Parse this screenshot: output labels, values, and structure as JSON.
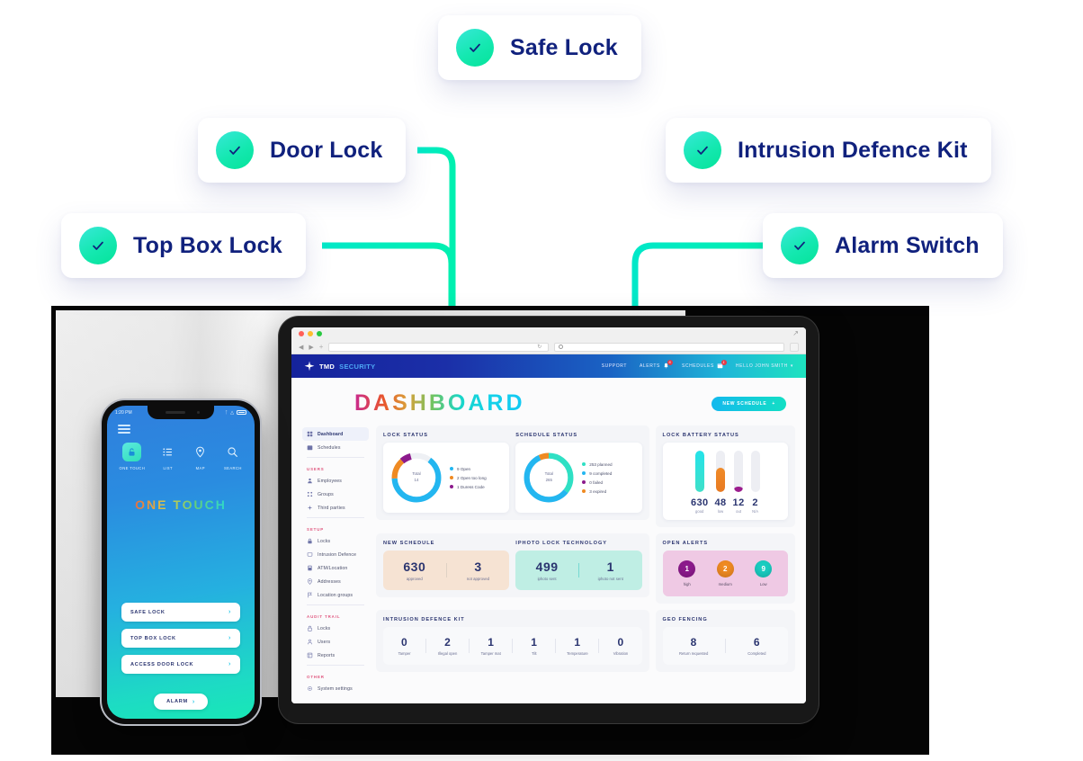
{
  "callouts": [
    {
      "id": "safe-lock",
      "label": "Safe Lock"
    },
    {
      "id": "door-lock",
      "label": "Door Lock"
    },
    {
      "id": "intrusion-kit",
      "label": "Intrusion Defence Kit"
    },
    {
      "id": "top-box-lock",
      "label": "Top Box Lock"
    },
    {
      "id": "alarm-switch",
      "label": "Alarm Switch"
    }
  ],
  "colors": {
    "connector_start": "#00d8ff",
    "connector_end": "#00f5a8",
    "callout_text": "#10217d",
    "accent_cyan": "#13b9ee",
    "accent_teal": "#13dfc4",
    "alert_high": "#8c1a8c",
    "alert_medium": "#ef8a22",
    "alert_low": "#19ccc0",
    "battery_good": "#17d8e8",
    "battery_low": "#ee832a",
    "battery_out": "#9c1d8e"
  },
  "tablet": {
    "browser": {
      "reload_icon": "reload-icon",
      "search_icon": "search-icon",
      "new_tab_icon": "plus-icon"
    },
    "appnav": {
      "brand_main": "TMD",
      "brand_sub": "SECURITY",
      "items": [
        {
          "label": "SUPPORT",
          "badge": null
        },
        {
          "label": "ALERTS",
          "badge": "6",
          "icon": "bell-icon"
        },
        {
          "label": "SCHEDULES",
          "badge": "1",
          "icon": "calendar-icon"
        },
        {
          "label": "HELLO JOHN SMITH",
          "badge": null,
          "icon": "chevron-down-icon"
        }
      ]
    },
    "page_title": "DASHBOARD",
    "new_schedule_button": "NEW SCHEDULE",
    "sidebar": [
      {
        "type": "item",
        "label": "Dashboard",
        "icon": "grid-icon",
        "active": true
      },
      {
        "type": "item",
        "label": "Schedules",
        "icon": "calendar-icon",
        "active": false
      },
      {
        "type": "divider"
      },
      {
        "type": "section",
        "label": "USERS"
      },
      {
        "type": "item",
        "label": "Employees",
        "icon": "user-icon",
        "active": false
      },
      {
        "type": "item",
        "label": "Groups",
        "icon": "groups-icon",
        "active": false
      },
      {
        "type": "item",
        "label": "Third parties",
        "icon": "plus-cross-icon",
        "active": false
      },
      {
        "type": "divider"
      },
      {
        "type": "section",
        "label": "SETUP"
      },
      {
        "type": "item",
        "label": "Locks",
        "icon": "lock-icon",
        "active": false
      },
      {
        "type": "item",
        "label": "Intrusion Defence",
        "icon": "shield-icon",
        "active": false
      },
      {
        "type": "item",
        "label": "ATM/Location",
        "icon": "atm-icon",
        "active": false
      },
      {
        "type": "item",
        "label": "Addresses",
        "icon": "pin-icon",
        "active": false
      },
      {
        "type": "item",
        "label": "Location groups",
        "icon": "flag-icon",
        "active": false
      },
      {
        "type": "divider"
      },
      {
        "type": "section",
        "label": "AUDIT TRAIL"
      },
      {
        "type": "item",
        "label": "Locks",
        "icon": "lock-icon",
        "active": false
      },
      {
        "type": "item",
        "label": "Users",
        "icon": "user-icon",
        "active": false
      },
      {
        "type": "item",
        "label": "Reports",
        "icon": "report-icon",
        "active": false
      },
      {
        "type": "divider"
      },
      {
        "type": "section",
        "label": "OTHER"
      },
      {
        "type": "item",
        "label": "System settings",
        "icon": "gear-icon",
        "active": false
      }
    ],
    "panels": {
      "lock_status": {
        "title": "LOCK STATUS",
        "total_label": "Total",
        "total_value": "14",
        "legend": [
          {
            "label": "9 Open",
            "color": "#23b6f0",
            "value": 9
          },
          {
            "label": "2 Open too long",
            "color": "#ef8a22",
            "value": 2
          },
          {
            "label": "1 Duress Code",
            "color": "#8c1a8c",
            "value": 1
          }
        ]
      },
      "schedule_status": {
        "title": "SCHEDULE STATUS",
        "total_label": "Total",
        "total_value": "265",
        "legend": [
          {
            "label": "253 planned",
            "color": "#2fe0c4",
            "value": 253
          },
          {
            "label": "9 completed",
            "color": "#23b6f0",
            "value": 9
          },
          {
            "label": "0 failed",
            "color": "#8c1a8c",
            "value": 0
          },
          {
            "label": "3 expired",
            "color": "#ef8a22",
            "value": 3
          }
        ]
      },
      "lock_battery_status": {
        "title": "LOCK BATTERY STATUS",
        "bars": [
          {
            "value": "630",
            "label": "good",
            "fill_pct": 100,
            "color": "#17d8e8"
          },
          {
            "value": "48",
            "label": "low",
            "fill_pct": 58,
            "color": "#ee832a"
          },
          {
            "value": "12",
            "label": "out",
            "fill_pct": 14,
            "color": "#9c1d8e"
          },
          {
            "value": "2",
            "label": "N/A",
            "fill_pct": 0,
            "color": "#edeef3"
          }
        ]
      },
      "new_schedule": {
        "title": "NEW SCHEDULE",
        "bg": "#f6e3d3",
        "stats": [
          {
            "value": "630",
            "label": "approved"
          },
          {
            "value": "3",
            "label": "not approved"
          }
        ]
      },
      "iphoto_lock_technology": {
        "title": "IPHOTO LOCK TECHNOLOGY",
        "bg": "#bfeee4",
        "stats": [
          {
            "value": "499",
            "label": "iphoto sent"
          },
          {
            "value": "1",
            "label": "iphoto not sent"
          }
        ]
      },
      "open_alerts": {
        "title": "OPEN ALERTS",
        "bg": "#efc9e4",
        "alerts": [
          {
            "value": "1",
            "label": "high",
            "color": "#8c1a8c"
          },
          {
            "value": "2",
            "label": "medium",
            "color": "#ef8a22"
          },
          {
            "value": "9",
            "label": "Low",
            "color": "#19ccc0"
          }
        ]
      },
      "intrusion_defence_kit": {
        "title": "INTRUSION DEFENCE KIT",
        "stats": [
          {
            "value": "0",
            "label": "Tamper"
          },
          {
            "value": "2",
            "label": "Illegal open"
          },
          {
            "value": "1",
            "label": "Tamper mat"
          },
          {
            "value": "1",
            "label": "Tilt"
          },
          {
            "value": "1",
            "label": "Temperature"
          },
          {
            "value": "0",
            "label": "Vibration"
          }
        ]
      },
      "geo_fencing": {
        "title": "GEO FENCING",
        "stats": [
          {
            "value": "8",
            "label": "Return requested"
          },
          {
            "value": "6",
            "label": "Completed"
          }
        ]
      }
    }
  },
  "phone": {
    "status_time": "1:20 PM",
    "status_icons": [
      "bluetooth-icon",
      "wifi-icon",
      "battery-icon"
    ],
    "menu_icon": "hamburger-icon",
    "tabs": [
      {
        "label": "ONE TOUCH",
        "icon": "lock-icon",
        "active": true
      },
      {
        "label": "LIST",
        "icon": "list-icon",
        "active": false
      },
      {
        "label": "MAP",
        "icon": "pin-icon",
        "active": false
      },
      {
        "label": "SEARCH",
        "icon": "search-icon",
        "active": false
      }
    ],
    "title": "ONE TOUCH",
    "buttons": [
      {
        "label": "SAFE LOCK"
      },
      {
        "label": "TOP BOX LOCK"
      },
      {
        "label": "ACCESS DOOR LOCK"
      }
    ],
    "alarm_button": "ALARM"
  }
}
